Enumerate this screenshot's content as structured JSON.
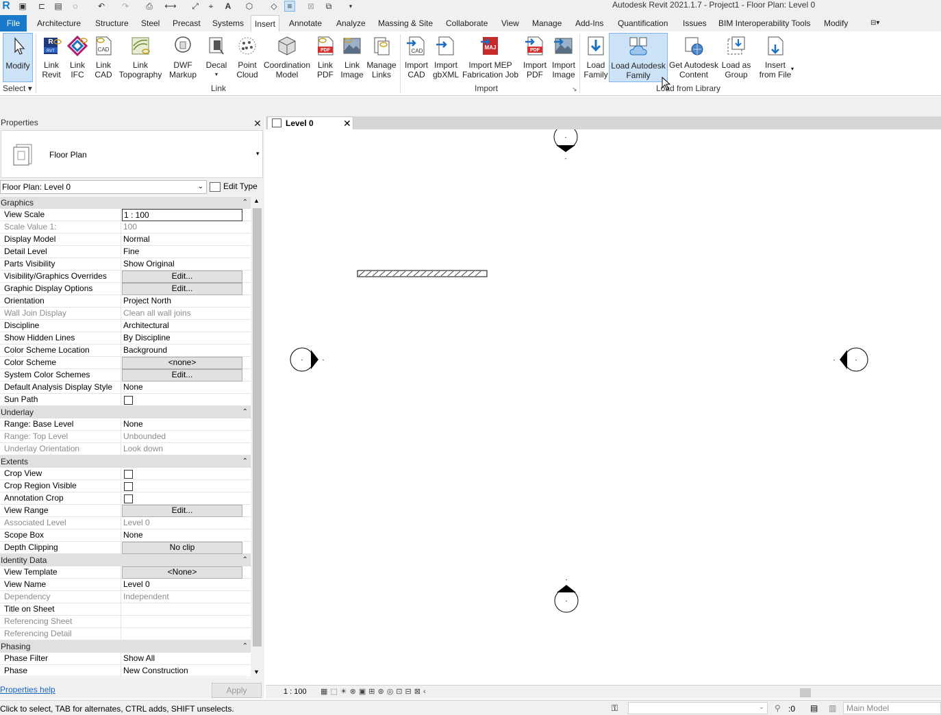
{
  "app": {
    "title": "Autodesk Revit 2021.1.7 - Project1 - Floor Plan: Level 0"
  },
  "tabs": [
    "File",
    "Architecture",
    "Structure",
    "Steel",
    "Precast",
    "Systems",
    "Insert",
    "Annotate",
    "Analyze",
    "Massing & Site",
    "Collaborate",
    "View",
    "Manage",
    "Add-Ins",
    "Quantification",
    "Issues",
    "BIM Interoperability Tools",
    "Modify"
  ],
  "active_tab": "Insert",
  "ribbon": {
    "select": {
      "modify": "Modify",
      "select_label": "Select"
    },
    "link": {
      "label": "Link",
      "buttons": [
        [
          "Link",
          "Revit"
        ],
        [
          "Link",
          "IFC"
        ],
        [
          "Link",
          "CAD"
        ],
        [
          "Link",
          "Topography"
        ],
        [
          "DWF",
          "Markup"
        ],
        [
          "Decal",
          ""
        ],
        [
          "Point",
          "Cloud"
        ],
        [
          "Coordination",
          "Model"
        ],
        [
          "Link",
          "PDF"
        ],
        [
          "Link",
          "Image"
        ],
        [
          "Manage",
          "Links"
        ]
      ]
    },
    "import": {
      "label": "Import",
      "buttons": [
        [
          "Import",
          "CAD"
        ],
        [
          "Import",
          "gbXML"
        ],
        [
          "Import MEP",
          "Fabrication Job"
        ],
        [
          "Import",
          "PDF"
        ],
        [
          "Import",
          "Image"
        ]
      ]
    },
    "library": {
      "label": "Load from Library",
      "buttons": [
        [
          "Load",
          "Family"
        ],
        [
          "Load Autodesk",
          "Family"
        ],
        [
          "Get Autodesk",
          "Content"
        ],
        [
          "Load as",
          "Group"
        ],
        [
          "Insert",
          "from File"
        ]
      ]
    },
    "icon_text": {
      "rvt": "RVT",
      "cad": "CAD",
      "pdf": "PDF",
      "maj": "MAJ"
    }
  },
  "properties": {
    "title": "Properties",
    "type_name": "Floor Plan",
    "instance": "Floor Plan: Level 0",
    "edit_type": "Edit Type",
    "help": "Properties help",
    "apply": "Apply",
    "groups": [
      {
        "name": "Graphics",
        "rows": [
          {
            "n": "View Scale",
            "v": "1 : 100",
            "k": "edit"
          },
          {
            "n": "Scale Value    1:",
            "v": "100",
            "k": "dis"
          },
          {
            "n": "Display Model",
            "v": "Normal"
          },
          {
            "n": "Detail Level",
            "v": "Fine"
          },
          {
            "n": "Parts Visibility",
            "v": "Show Original"
          },
          {
            "n": "Visibility/Graphics Overrides",
            "v": "Edit...",
            "k": "btn"
          },
          {
            "n": "Graphic Display Options",
            "v": "Edit...",
            "k": "btn"
          },
          {
            "n": "Orientation",
            "v": "Project North"
          },
          {
            "n": "Wall Join Display",
            "v": "Clean all wall joins",
            "k": "dis"
          },
          {
            "n": "Discipline",
            "v": "Architectural"
          },
          {
            "n": "Show Hidden Lines",
            "v": "By Discipline"
          },
          {
            "n": "Color Scheme Location",
            "v": "Background"
          },
          {
            "n": "Color Scheme",
            "v": "<none>",
            "k": "btn"
          },
          {
            "n": "System Color Schemes",
            "v": "Edit...",
            "k": "btn"
          },
          {
            "n": "Default Analysis Display Style",
            "v": "None"
          },
          {
            "n": "Sun Path",
            "v": "",
            "k": "cb"
          }
        ]
      },
      {
        "name": "Underlay",
        "rows": [
          {
            "n": "Range: Base Level",
            "v": "None"
          },
          {
            "n": "Range: Top Level",
            "v": "Unbounded",
            "k": "dis"
          },
          {
            "n": "Underlay Orientation",
            "v": "Look down",
            "k": "dis"
          }
        ]
      },
      {
        "name": "Extents",
        "rows": [
          {
            "n": "Crop View",
            "v": "",
            "k": "cb"
          },
          {
            "n": "Crop Region Visible",
            "v": "",
            "k": "cb"
          },
          {
            "n": "Annotation Crop",
            "v": "",
            "k": "cb"
          },
          {
            "n": "View Range",
            "v": "Edit...",
            "k": "btn"
          },
          {
            "n": "Associated Level",
            "v": "Level 0",
            "k": "dis"
          },
          {
            "n": "Scope Box",
            "v": "None"
          },
          {
            "n": "Depth Clipping",
            "v": "No clip",
            "k": "btn"
          }
        ]
      },
      {
        "name": "Identity Data",
        "rows": [
          {
            "n": "View Template",
            "v": "<None>",
            "k": "btn"
          },
          {
            "n": "View Name",
            "v": "Level 0"
          },
          {
            "n": "Dependency",
            "v": "Independent",
            "k": "dis"
          },
          {
            "n": "Title on Sheet",
            "v": ""
          },
          {
            "n": "Referencing Sheet",
            "v": "",
            "k": "dis"
          },
          {
            "n": "Referencing Detail",
            "v": "",
            "k": "dis"
          }
        ]
      },
      {
        "name": "Phasing",
        "rows": [
          {
            "n": "Phase Filter",
            "v": "Show All"
          },
          {
            "n": "Phase",
            "v": "New Construction"
          }
        ]
      }
    ]
  },
  "view": {
    "tab": "Level 0",
    "scale": "1 : 100"
  },
  "status": {
    "message": "Click to select, TAB for alternates, CTRL adds, SHIFT unselects.",
    "filter": ":0",
    "model": "Main Model"
  }
}
